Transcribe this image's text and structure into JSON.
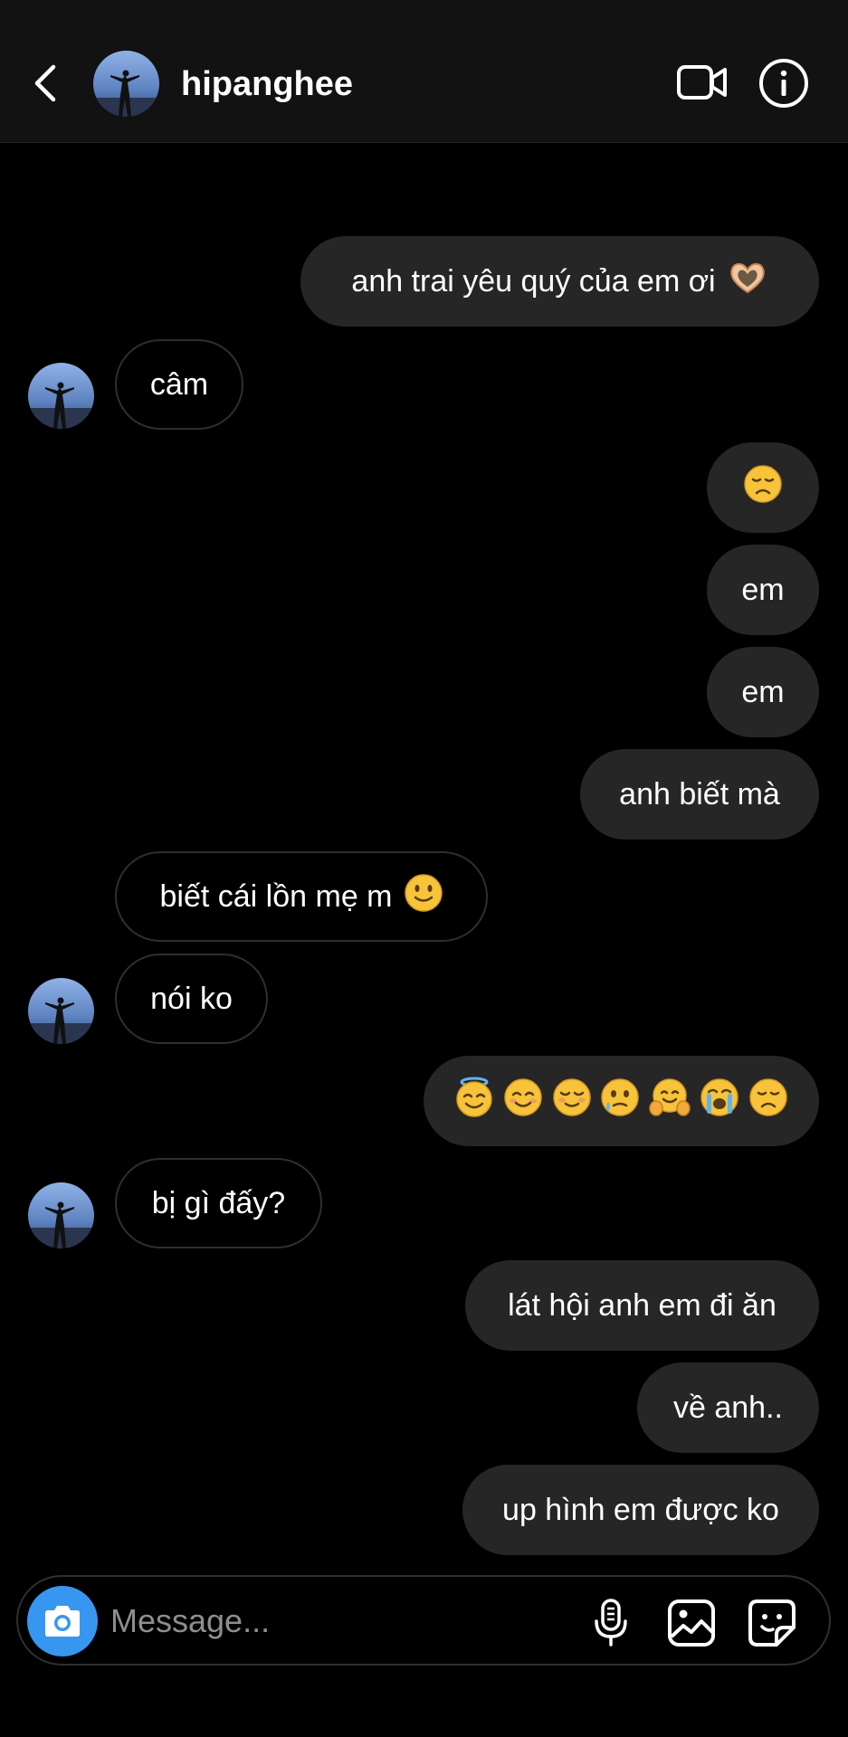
{
  "header": {
    "username": "hipanghee"
  },
  "messages": [
    {
      "side": "sent",
      "text": "anh trai yêu quý của em ơi"
    },
    {
      "side": "recv",
      "text": "câm"
    },
    {
      "side": "sent",
      "text": ""
    },
    {
      "side": "sent",
      "text": "em"
    },
    {
      "side": "sent",
      "text": "em"
    },
    {
      "side": "sent",
      "text": "anh biết mà"
    },
    {
      "side": "recv",
      "text": "biết cái lồn mẹ m"
    },
    {
      "side": "recv",
      "text": "nói ko"
    },
    {
      "side": "sent",
      "text": ""
    },
    {
      "side": "recv",
      "text": "bị gì đấy?"
    },
    {
      "side": "sent",
      "text": "lát hội anh em đi ăn"
    },
    {
      "side": "sent",
      "text": "về anh.."
    },
    {
      "side": "sent",
      "text": "up hình em được ko"
    }
  ],
  "emoji_icons": {
    "m0": "heart-hands-icon",
    "m2": "disappointed-face-icon",
    "m6": "slightly-smiling-face-icon",
    "m8": [
      "smiling-face-with-halo-icon",
      "smiling-face-with-smiling-eyes-icon",
      "smiling-face-icon",
      "face-holding-back-tears-icon",
      "hugging-face-icon",
      "loudly-crying-face-icon",
      "disappointed-face-icon"
    ]
  },
  "composer": {
    "placeholder": "Message..."
  },
  "colors": {
    "header_bg": "#121212",
    "sent_bubble": "#262626",
    "received_border": "#2f2f2f",
    "camera_button": "#3797f0",
    "placeholder": "#8e8e8e"
  }
}
